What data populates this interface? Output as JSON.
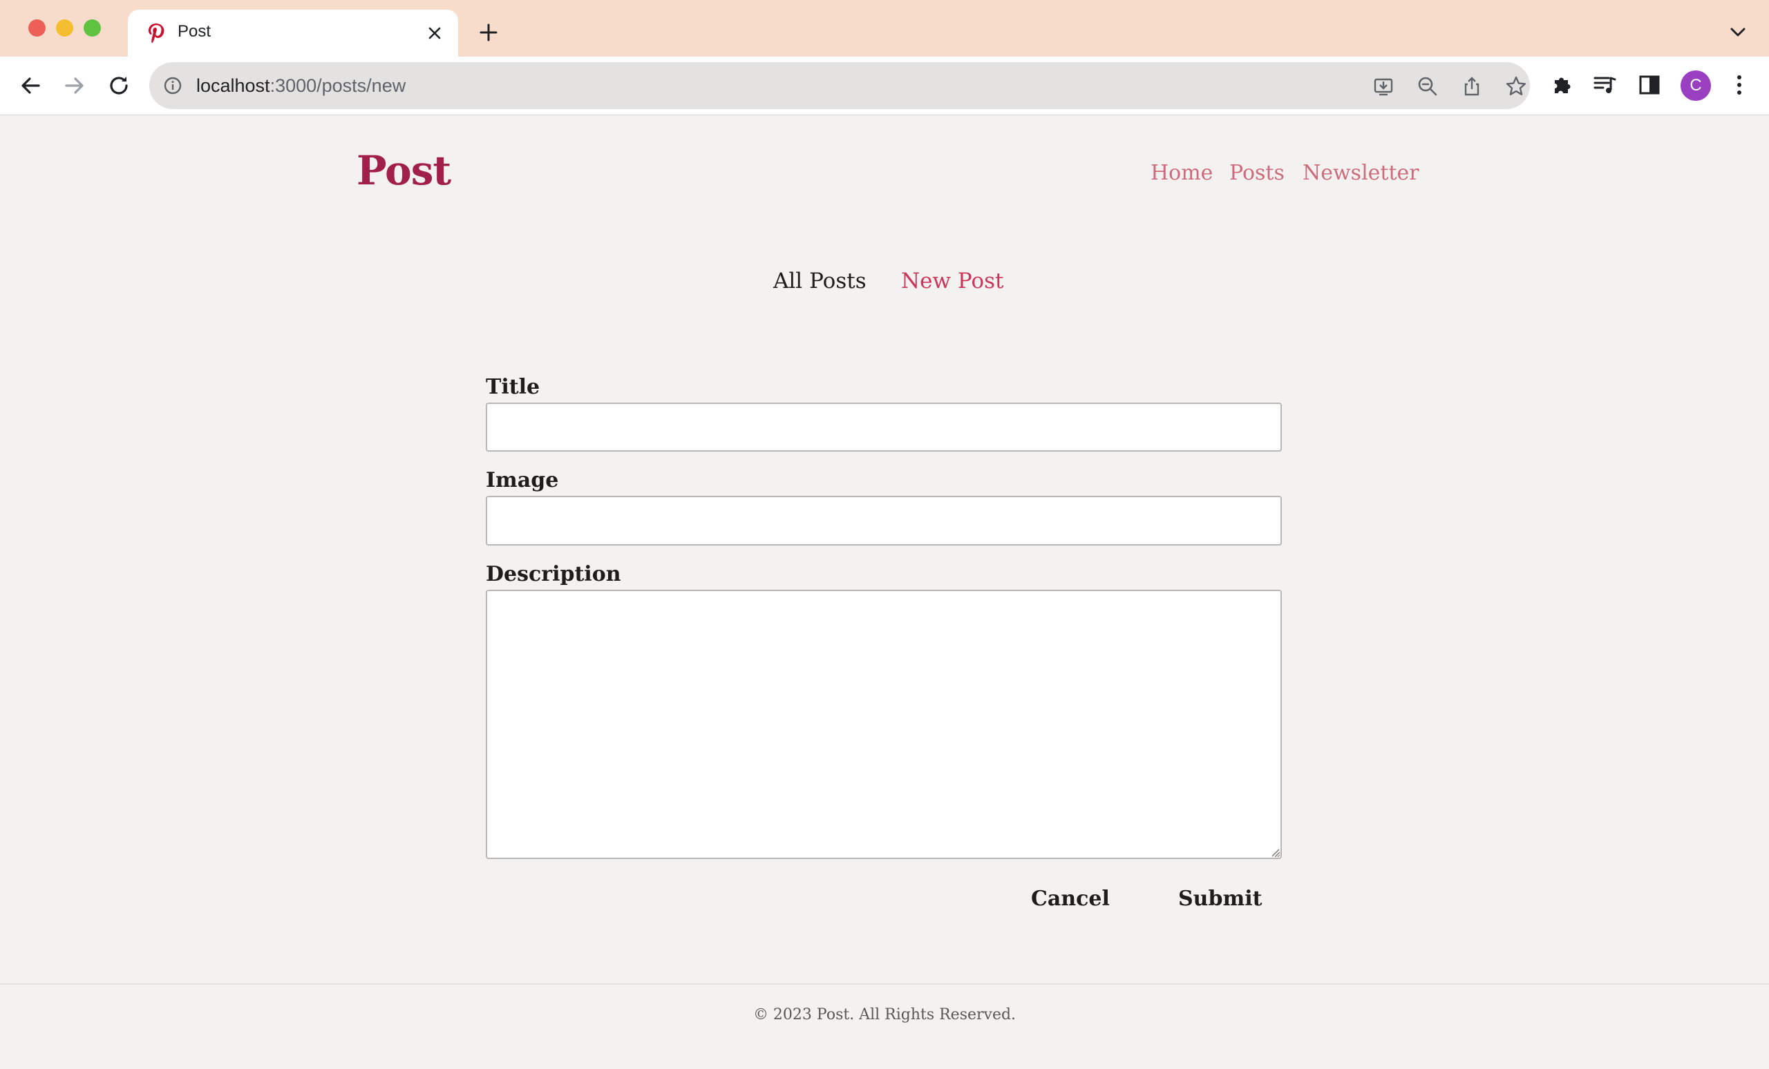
{
  "browser": {
    "tab_title": "Post",
    "url_host": "localhost",
    "url_path": ":3000/posts/new",
    "profile_initial": "C"
  },
  "site": {
    "brand": "Post",
    "nav": [
      "Home",
      "Posts",
      "Newsletter"
    ],
    "subnav": {
      "all_posts": "All Posts",
      "new_post": "New Post"
    },
    "brand_color": "#a11f4b",
    "accent_color": "#c9365a"
  },
  "form": {
    "title_label": "Title",
    "title_value": "",
    "image_label": "Image",
    "image_value": "",
    "description_label": "Description",
    "description_value": "",
    "cancel_label": "Cancel",
    "submit_label": "Submit"
  },
  "footer": {
    "text": "© 2023 Post. All Rights Reserved."
  }
}
